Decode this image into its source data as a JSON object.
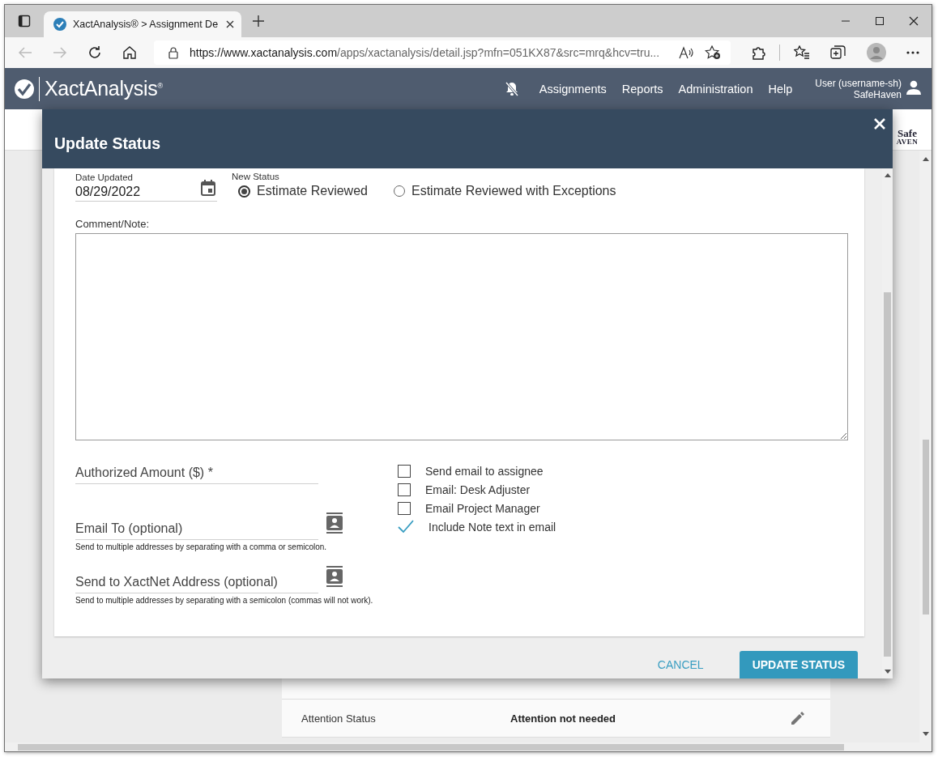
{
  "browser": {
    "tab_title": "XactAnalysis® > Assignment De",
    "url_host": "https://www.xactanalysis.com",
    "url_path": "/apps/xactanalysis/detail.jsp?mfn=051KX87&src=mrq&hcv=tru..."
  },
  "app_header": {
    "logo": "XactAnalysis$^{®}$",
    "nav": [
      "Assignments",
      "Reports",
      "Administration",
      "Help"
    ],
    "user": "User (username-sh)",
    "company": "SafeHaven"
  },
  "page": {
    "partner_logo": {
      "line1": "Safe",
      "line2": "AVEN"
    },
    "details": [
      {
        "label": "Attention Status",
        "value": "Attention not needed"
      }
    ]
  },
  "modal": {
    "title": "Update Status",
    "date_label": "Date Updated",
    "date_value": "08/29/2022",
    "status_label": "New Status",
    "statuses": [
      {
        "label": "Estimate Reviewed",
        "selected": true
      },
      {
        "label": "Estimate Reviewed with Exceptions",
        "selected": false
      }
    ],
    "comment_label": "Comment/Note:",
    "amount": {
      "placeholder": "Authorized Amount ($) *"
    },
    "email_to": {
      "placeholder": "Email To (optional)",
      "hint": "Send to multiple addresses by separating with a comma or semicolon."
    },
    "xactnet": {
      "placeholder": "Send to XactNet Address (optional)",
      "hint": "Send to multiple addresses by separating with a semicolon (commas will not work)."
    },
    "options": [
      {
        "label": "Send email to assignee",
        "checked": false
      },
      {
        "label": "Email: Desk Adjuster",
        "checked": false
      },
      {
        "label": "Email Project Manager",
        "checked": false
      },
      {
        "label": "Include Note text in email",
        "checked": true
      }
    ],
    "buttons": [
      {
        "label": "CANCEL",
        "kind": "text"
      },
      {
        "label": "UPDATE STATUS",
        "kind": "primary"
      }
    ]
  }
}
